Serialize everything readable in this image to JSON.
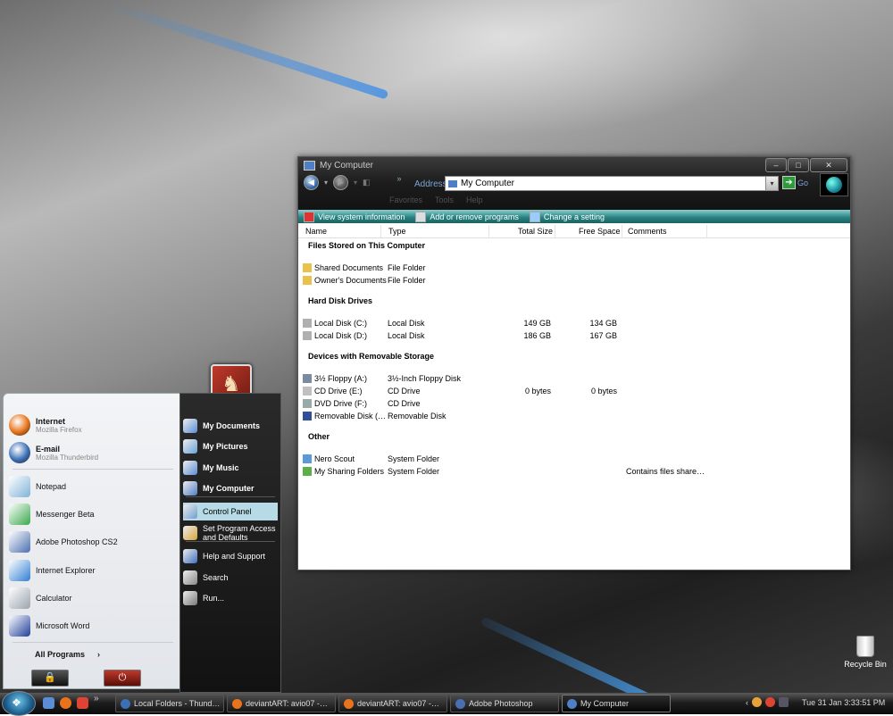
{
  "desktop": {
    "recycle_bin": "Recycle Bin"
  },
  "explorer": {
    "title": "My Computer",
    "address_label": "Address",
    "address_value": "My Computer",
    "go_label": "Go",
    "menu": [
      "Favorites",
      "Tools",
      "Help"
    ],
    "tasks": [
      "View system information",
      "Add or remove programs",
      "Change a setting"
    ],
    "columns": [
      "Name",
      "Type",
      "Total Size",
      "Free Space",
      "Comments"
    ],
    "groups": [
      {
        "title": "Files Stored on This Computer",
        "items": [
          {
            "name": "Shared Documents",
            "type": "File Folder",
            "total": "",
            "free": "",
            "comments": "",
            "icon": "folder-icon"
          },
          {
            "name": "Owner's Documents",
            "type": "File Folder",
            "total": "",
            "free": "",
            "comments": "",
            "icon": "folder-icon"
          }
        ]
      },
      {
        "title": "Hard Disk Drives",
        "items": [
          {
            "name": "Local Disk (C:)",
            "type": "Local Disk",
            "total": "149 GB",
            "free": "134 GB",
            "comments": "",
            "icon": "hard-disk-icon"
          },
          {
            "name": "Local Disk (D:)",
            "type": "Local Disk",
            "total": "186 GB",
            "free": "167 GB",
            "comments": "",
            "icon": "hard-disk-icon"
          }
        ]
      },
      {
        "title": "Devices with Removable Storage",
        "items": [
          {
            "name": "3½ Floppy (A:)",
            "type": "3½-Inch Floppy Disk",
            "total": "",
            "free": "",
            "comments": "",
            "icon": "floppy-icon"
          },
          {
            "name": "CD Drive (E:)",
            "type": "CD Drive",
            "total": "0 bytes",
            "free": "0 bytes",
            "comments": "",
            "icon": "cd-drive-icon"
          },
          {
            "name": "DVD Drive (F:)",
            "type": "CD Drive",
            "total": "",
            "free": "",
            "comments": "",
            "icon": "dvd-drive-icon"
          },
          {
            "name": "Removable Disk (…",
            "type": "Removable Disk",
            "total": "",
            "free": "",
            "comments": "",
            "icon": "removable-disk-icon"
          }
        ]
      },
      {
        "title": "Other",
        "items": [
          {
            "name": "Nero Scout",
            "type": "System Folder",
            "total": "",
            "free": "",
            "comments": "",
            "icon": "nero-scout-icon"
          },
          {
            "name": "My Sharing Folders",
            "type": "System Folder",
            "total": "",
            "free": "",
            "comments": "Contains files share…",
            "icon": "sharing-folder-icon"
          }
        ]
      }
    ]
  },
  "start_menu": {
    "pinned": [
      {
        "title": "Internet",
        "subtitle": "Mozilla Firefox",
        "icon": "firefox-icon",
        "color": "#e8731a"
      },
      {
        "title": "E-mail",
        "subtitle": "Mozilla Thunderbird",
        "icon": "thunderbird-icon",
        "color": "#3b6fb6"
      }
    ],
    "recent": [
      {
        "label": "Notepad",
        "icon": "notepad-icon",
        "color": "#7fb3d9"
      },
      {
        "label": "Messenger Beta",
        "icon": "messenger-icon",
        "color": "#3aa84a"
      },
      {
        "label": "Adobe Photoshop CS2",
        "icon": "photoshop-icon",
        "color": "#4a6fb0"
      },
      {
        "label": "Internet Explorer",
        "icon": "internet-explorer-icon",
        "color": "#2f7fd3"
      },
      {
        "label": "Calculator",
        "icon": "calculator-icon",
        "color": "#9aa3ad"
      },
      {
        "label": "Microsoft Word",
        "icon": "word-icon",
        "color": "#1f3f9a"
      }
    ],
    "all_programs": "All Programs",
    "right": [
      {
        "label": "My Documents",
        "bold": true,
        "icon": "my-documents-icon",
        "color": "#5b8dd6"
      },
      {
        "label": "My Pictures",
        "bold": true,
        "icon": "my-pictures-icon",
        "color": "#6aa1d9"
      },
      {
        "label": "My Music",
        "bold": true,
        "icon": "my-music-icon",
        "color": "#5b8dd6"
      },
      {
        "label": "My Computer",
        "bold": true,
        "icon": "my-computer-icon",
        "color": "#4f7fc4"
      },
      {
        "label": "Control Panel",
        "bold": false,
        "icon": "control-panel-icon",
        "color": "#6f9fcf"
      },
      {
        "label": "Set Program Access and Defaults",
        "bold": false,
        "icon": "program-defaults-icon",
        "color": "#d9a23a"
      },
      {
        "label": "Help and Support",
        "bold": false,
        "icon": "help-icon",
        "color": "#3f6fbf"
      },
      {
        "label": "Search",
        "bold": false,
        "icon": "search-icon",
        "color": "#888888"
      },
      {
        "label": "Run...",
        "bold": false,
        "icon": "run-icon",
        "color": "#777777"
      }
    ]
  },
  "taskbar": {
    "buttons": [
      {
        "label": "Local Folders - Thund…",
        "icon": "thunderbird-icon",
        "color": "#3b6fb6",
        "active": false
      },
      {
        "label": "deviantART: avio07 -…",
        "icon": "firefox-icon",
        "color": "#e8731a",
        "active": false
      },
      {
        "label": "deviantART: avio07 -…",
        "icon": "firefox-icon",
        "color": "#e8731a",
        "active": false
      },
      {
        "label": "Adobe Photoshop",
        "icon": "photoshop-icon",
        "color": "#4a6fb0",
        "active": false
      },
      {
        "label": "My Computer",
        "icon": "my-computer-icon",
        "color": "#4f7fc4",
        "active": true
      }
    ],
    "clock": "Tue 31 Jan 3:33:51 PM",
    "quick_launch_chevron": "»"
  }
}
